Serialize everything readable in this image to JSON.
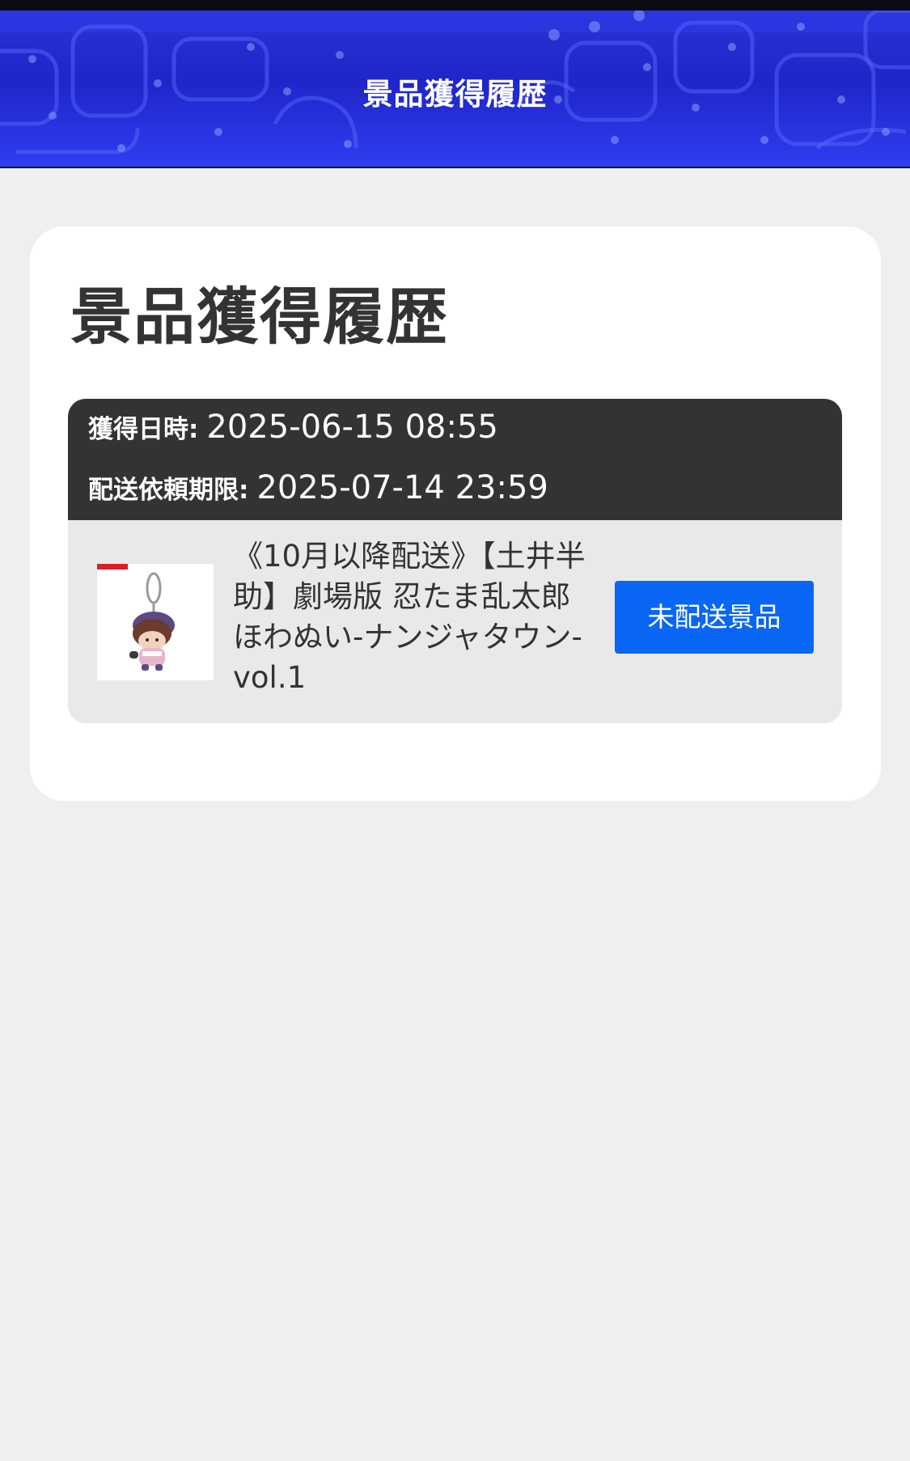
{
  "header": {
    "title": "景品獲得履歴"
  },
  "main": {
    "title": "景品獲得履歴",
    "prizes": [
      {
        "acquired_label": "獲得日時:",
        "acquired_value": "2025-06-15 08:55",
        "deadline_label": "配送依頼期限:",
        "deadline_value": "2025-07-14 23:59",
        "name": "《10月以降配送》【土井半助】劇場版 忍たま乱太郎 ほわぬい-ナンジャタウン-vol.1",
        "thumbnail_icon": "plush-keychain-image",
        "button_label": "未配送景品"
      }
    ]
  },
  "colors": {
    "header_blue": "#2b34d6",
    "card_head_dark": "#333333",
    "button_blue": "#0a66f5",
    "page_bg": "#efefef"
  }
}
